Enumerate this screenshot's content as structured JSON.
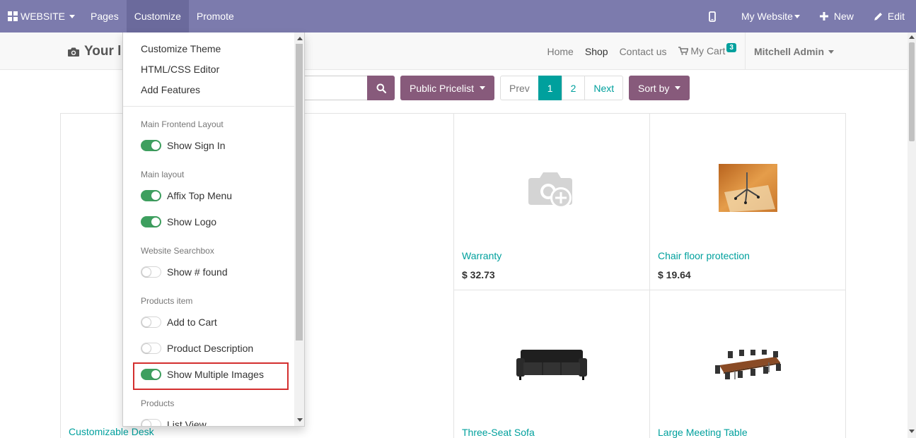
{
  "topbar": {
    "website_label": "WEBSITE",
    "pages": "Pages",
    "customize": "Customize",
    "promote": "Promote",
    "my_website": "My Website",
    "new": "New",
    "edit": "Edit"
  },
  "header": {
    "logo_text": "Your l",
    "nav": [
      "Home",
      "Shop",
      "Contact us"
    ],
    "cart_label": "My Cart",
    "cart_count": "3",
    "user": "Mitchell Admin"
  },
  "controls": {
    "pricelist": "Public Pricelist",
    "pager": [
      "Prev",
      "1",
      "2",
      "Next"
    ],
    "sort": "Sort by"
  },
  "customize_menu": {
    "top_items": [
      "Customize Theme",
      "HTML/CSS Editor",
      "Add Features"
    ],
    "sections": [
      {
        "header": "Main Frontend Layout",
        "options": [
          {
            "label": "Show Sign In",
            "enabled": true
          }
        ]
      },
      {
        "header": "Main layout",
        "options": [
          {
            "label": "Affix Top Menu",
            "enabled": true
          },
          {
            "label": "Show Logo",
            "enabled": true
          }
        ]
      },
      {
        "header": "Website Searchbox",
        "options": [
          {
            "label": "Show # found",
            "enabled": false
          }
        ]
      },
      {
        "header": "Products item",
        "options": [
          {
            "label": "Add to Cart",
            "enabled": false
          },
          {
            "label": "Product Description",
            "enabled": false
          },
          {
            "label": "Show Multiple Images",
            "enabled": true
          }
        ]
      },
      {
        "header": "Products",
        "options": [
          {
            "label": "List View",
            "enabled": false
          }
        ]
      }
    ]
  },
  "products": [
    {
      "name": "Customizable Desk",
      "price": ""
    },
    {
      "name": "Warranty",
      "price": "$ 32.73"
    },
    {
      "name": "Chair floor protection",
      "price": "$ 19.64"
    },
    {
      "name": "Three-Seat Sofa",
      "price": ""
    },
    {
      "name": "Large Meeting Table",
      "price": ""
    }
  ],
  "colors": {
    "topbar": "#7c7bad",
    "accent_teal": "#00a09d",
    "button_purple": "#875a7b",
    "toggle_on": "#3e9f5f",
    "highlight_red": "#d32f2f"
  }
}
